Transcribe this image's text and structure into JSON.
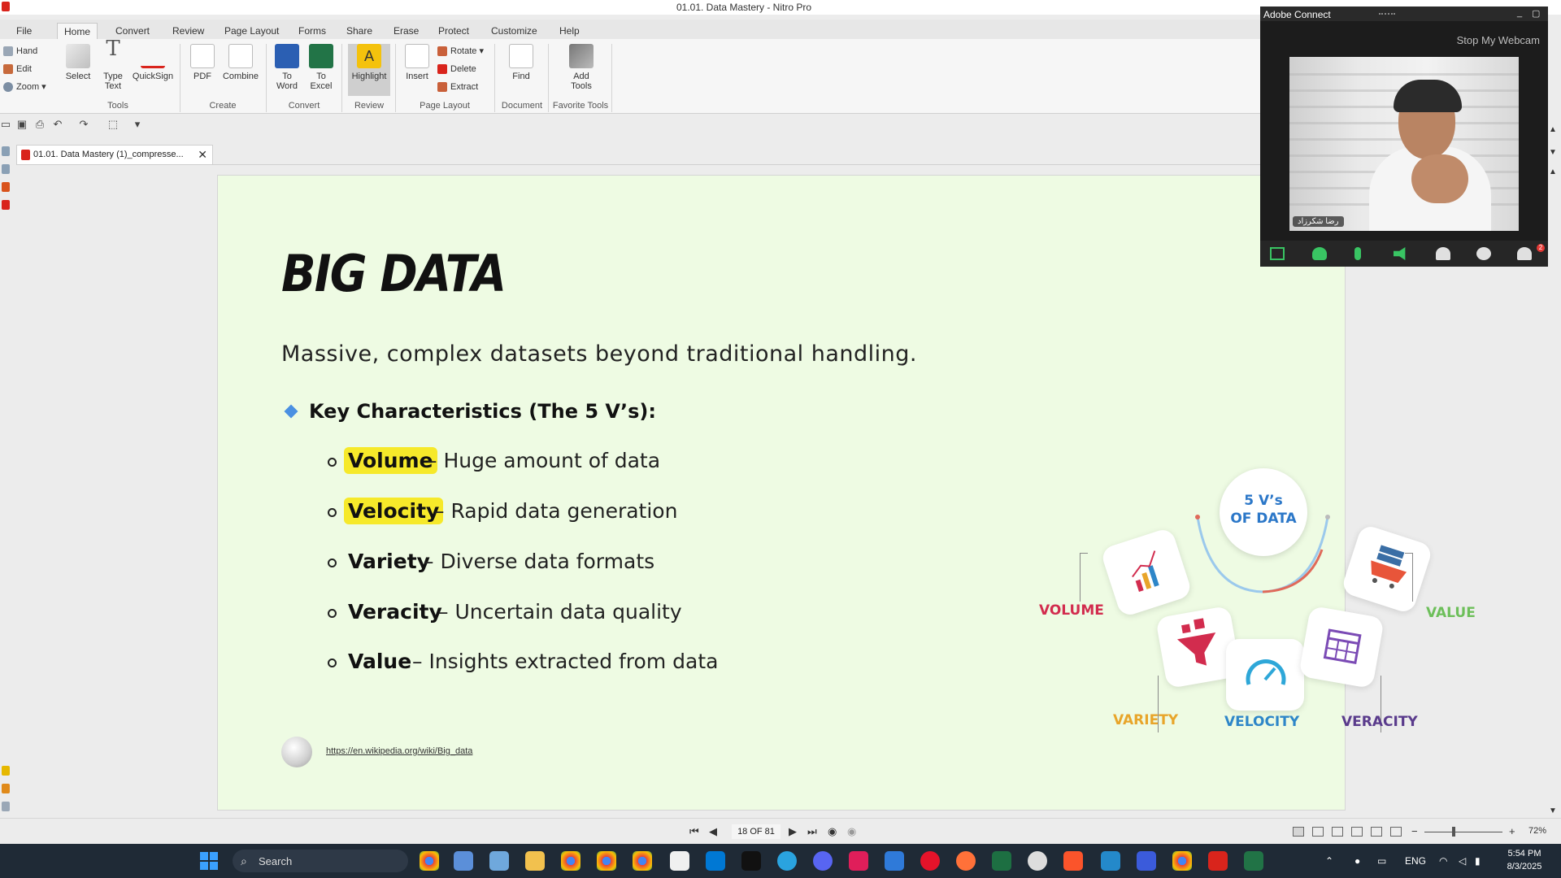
{
  "window": {
    "title": "01.01. Data Mastery - Nitro Pro"
  },
  "ribbon": {
    "tabs": [
      "File",
      "Home",
      "Convert",
      "Review",
      "Page Layout",
      "Forms",
      "Share",
      "Erase",
      "Protect",
      "Customize",
      "Help"
    ],
    "active_tab": "Home",
    "tools_small": [
      "Hand",
      "Edit",
      "Zoom"
    ],
    "buttons": {
      "select": "Select",
      "type_text": "Type Text",
      "quicksign": "QuickSign",
      "pdf": "PDF",
      "combine": "Combine",
      "to_word": "To Word",
      "to_excel": "To Excel",
      "highlight": "Highlight",
      "insert": "Insert",
      "rotate": "Rotate",
      "delete": "Delete",
      "extract": "Extract",
      "find": "Find",
      "add_tools": "Add Tools"
    },
    "groups": [
      "Tools",
      "Create",
      "Convert",
      "Review",
      "Page Layout",
      "Document",
      "Favorite Tools"
    ]
  },
  "document_tab": {
    "name": "01.01. Data Mastery (1)_compresse..."
  },
  "slide": {
    "title": "BIG DATA",
    "subtitle": "Massive, complex datasets beyond traditional handling.",
    "key_heading": "Key Characteristics (The 5 V’s):",
    "items": [
      {
        "term": "Volume",
        "desc": "– Huge amount of data",
        "highlighted": true
      },
      {
        "term": "Velocity",
        "desc": "– Rapid data generation",
        "highlighted": true
      },
      {
        "term": "Variety",
        "desc": "– Diverse data formats",
        "highlighted": false
      },
      {
        "term": "Veracity",
        "desc": "– Uncertain data quality",
        "highlighted": false
      },
      {
        "term": "Value",
        "desc": "– Insights extracted from data",
        "highlighted": false
      }
    ],
    "link": "https://en.wikipedia.org/wiki/Big_data",
    "infographic": {
      "center_line1": "5 V’s",
      "center_line2": "OF DATA",
      "labels": {
        "volume": "VOLUME",
        "value": "VALUE",
        "variety": "VARIETY",
        "velocity": "VELOCITY",
        "veracity": "VERACITY"
      },
      "colors": {
        "volume": "#d22c4e",
        "value": "#6dbf5a",
        "variety": "#e8a52a",
        "velocity": "#2e86c8",
        "veracity": "#5a3b8c",
        "center": "#2b77c8"
      }
    },
    "highlight_color": "#f6e92a",
    "background": "#eefbe3"
  },
  "statusbar": {
    "page": "18 OF 81",
    "zoom": "72%"
  },
  "adobe_connect": {
    "title": "Adobe Connect",
    "stop_webcam": "Stop My Webcam",
    "presenter_name": "رضا شکرزاد",
    "notification_count": "2"
  },
  "taskbar": {
    "search": "Search",
    "language": "ENG",
    "time": "5:54 PM",
    "date": "8/3/2025"
  }
}
